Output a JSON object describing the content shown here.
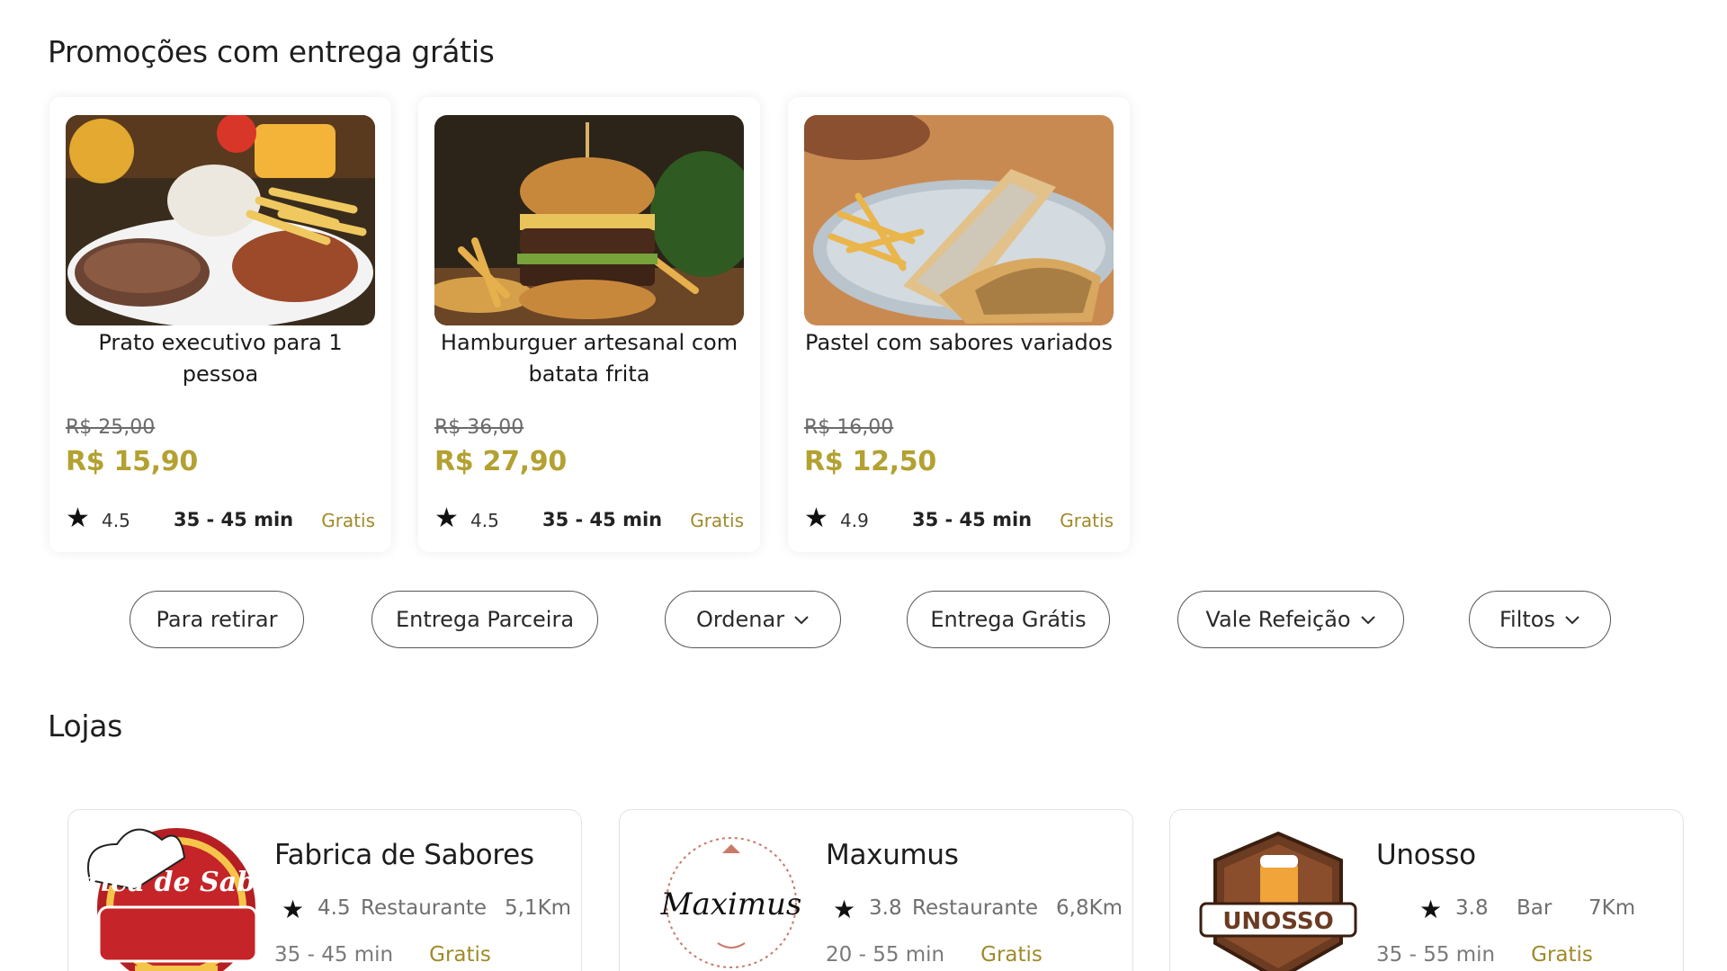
{
  "promo_section": {
    "title": "Promoções com entrega grátis"
  },
  "promos": [
    {
      "name": "Prato executivo para 1 pessoa",
      "old_price": "R$ 25,00",
      "price": "R$ 15,90",
      "rating": "4.5",
      "time": "35 - 45 min",
      "delivery": "Gratis",
      "image": "prato-executivo-photo"
    },
    {
      "name": "Hamburguer artesanal com batata frita",
      "old_price": "R$ 36,00",
      "price": "R$ 27,90",
      "rating": "4.5",
      "time": "35 - 45 min",
      "delivery": "Gratis",
      "image": "hamburguer-photo"
    },
    {
      "name": "Pastel com sabores variados",
      "old_price": "R$ 16,00",
      "price": "R$ 12,50",
      "rating": "4.9",
      "time": "35 - 45 min",
      "delivery": "Gratis",
      "image": "pastel-photo"
    }
  ],
  "filters": [
    {
      "label": "Para retirar",
      "has_dropdown": false
    },
    {
      "label": "Entrega Parceira",
      "has_dropdown": false
    },
    {
      "label": "Ordenar",
      "has_dropdown": true
    },
    {
      "label": "Entrega Grátis",
      "has_dropdown": false
    },
    {
      "label": "Vale Refeição",
      "has_dropdown": true
    },
    {
      "label": "Filtos",
      "has_dropdown": true
    }
  ],
  "stores_section": {
    "title": "Lojas"
  },
  "stores": [
    {
      "name": "Fabrica de Sabores",
      "rating": "4.5",
      "category": "Restaurante",
      "distance": "5,1Km",
      "time": "35 - 45 min",
      "delivery": "Gratis",
      "logo_text": "Fábrica de Sabores"
    },
    {
      "name": "Maxumus",
      "rating": "3.8",
      "category": "Restaurante",
      "distance": "6,8Km",
      "time": "20 - 55 min",
      "delivery": "Gratis",
      "logo_text": "Maximus"
    },
    {
      "name": "Unosso",
      "rating": "3.8",
      "category": "Bar",
      "distance": "7Km",
      "time": "35 - 55 min",
      "delivery": "Gratis",
      "logo_text": "UNOSSO"
    }
  ],
  "colors": {
    "price": "#b3a131",
    "free": "#a08a2a",
    "border": "#555555"
  },
  "icons": {
    "star": "star-icon",
    "dropdown": "chevron-down-icon"
  }
}
